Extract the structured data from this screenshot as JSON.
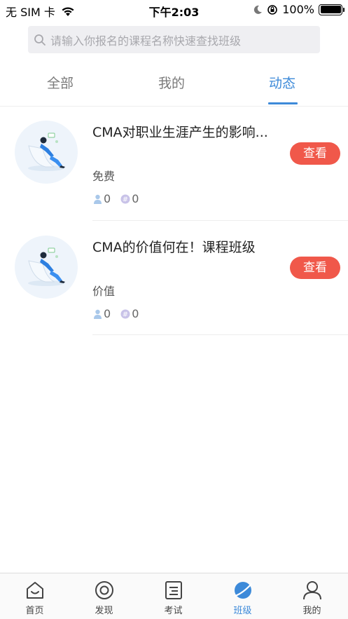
{
  "status_bar": {
    "carrier": "无 SIM 卡",
    "time": "下午2:03",
    "battery": "100%"
  },
  "search": {
    "placeholder": "请输入你报名的课程名称快速查找班级"
  },
  "tabs": [
    {
      "label": "全部",
      "active": false
    },
    {
      "label": "我的",
      "active": false
    },
    {
      "label": "动态",
      "active": true
    }
  ],
  "courses": [
    {
      "title": "CMA对职业生涯产生的影响...",
      "button": "查看",
      "tag": "免费",
      "students": "0",
      "topics": "0"
    },
    {
      "title": "CMA的价值何在！课程班级",
      "button": "查看",
      "tag": "价值",
      "students": "0",
      "topics": "0"
    }
  ],
  "bottom_nav": [
    {
      "label": "首页",
      "icon": "home-icon",
      "active": false
    },
    {
      "label": "发现",
      "icon": "discover-icon",
      "active": false
    },
    {
      "label": "考试",
      "icon": "exam-icon",
      "active": false
    },
    {
      "label": "班级",
      "icon": "class-icon",
      "active": true
    },
    {
      "label": "我的",
      "icon": "profile-icon",
      "active": false
    }
  ],
  "colors": {
    "accent": "#3d8ad9",
    "button": "#f0584a",
    "search_bg": "#efeff2"
  }
}
